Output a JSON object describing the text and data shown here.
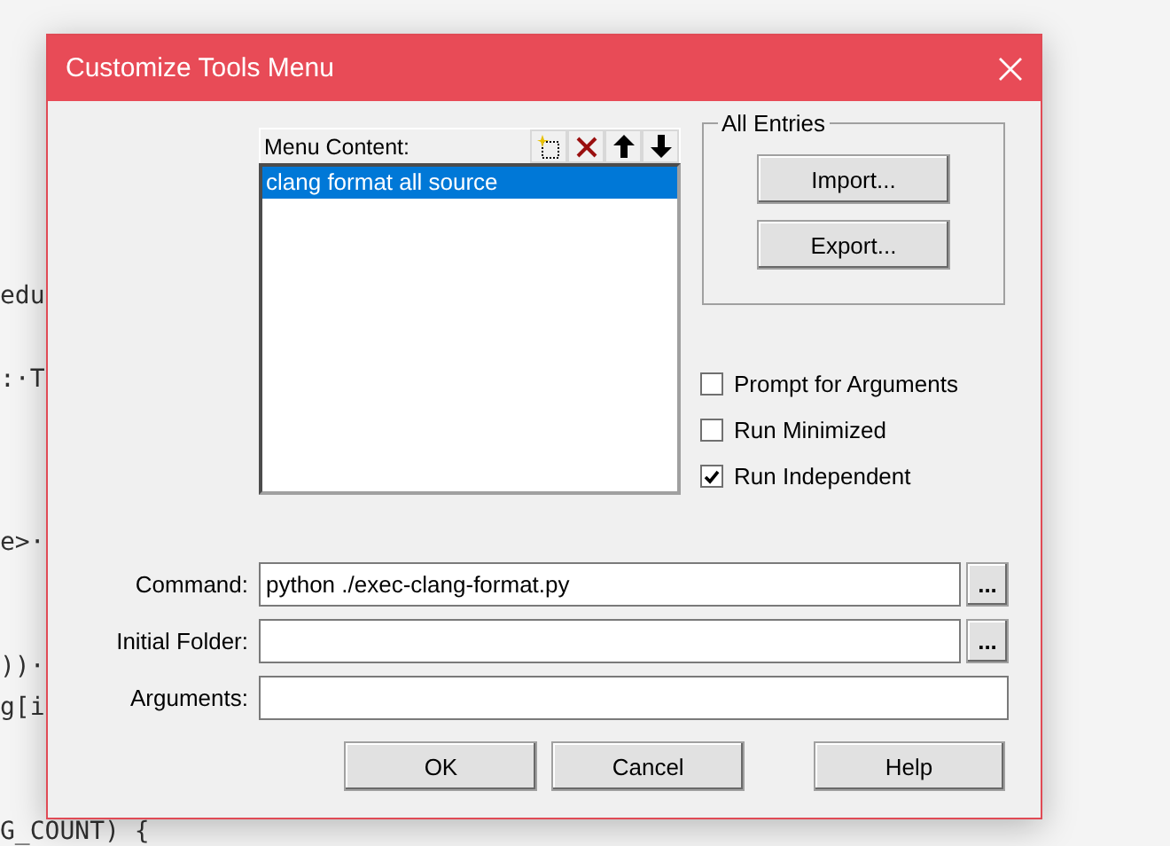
{
  "editor": {
    "lines": [
      {
        "text": "edu"
      },
      {
        "text": ":·T"
      },
      {
        "text": "e>·"
      },
      {
        "text": "))·"
      },
      {
        "text": "g[i"
      },
      {
        "text": "G_COUNT) {"
      }
    ]
  },
  "dialog": {
    "title": "Customize Tools Menu",
    "menu_content": {
      "label": "Menu Content:",
      "items": [
        {
          "label": "clang format all source",
          "selected": true
        }
      ]
    },
    "all_entries": {
      "title": "All Entries",
      "buttons": [
        "Import...",
        "Export..."
      ]
    },
    "options": [
      {
        "label": "Prompt for  Arguments",
        "checked": false
      },
      {
        "label": "Run Minimized",
        "checked": false
      },
      {
        "label": "Run Independent",
        "checked": true
      }
    ],
    "fields": [
      {
        "label": "Command:",
        "value": "python ./exec-clang-format.py",
        "browse": "..."
      },
      {
        "label": "Initial Folder:",
        "browse": "..."
      },
      {
        "label": "Arguments:"
      }
    ],
    "buttons": [
      "OK",
      "Cancel"
    ],
    "help_button": "Help"
  }
}
